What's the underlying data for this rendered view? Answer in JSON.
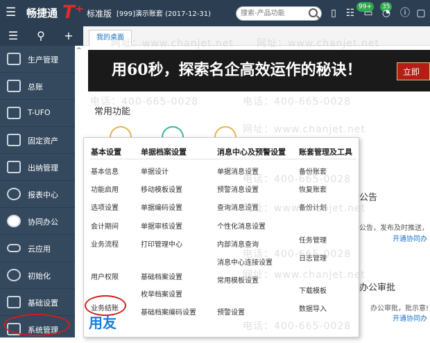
{
  "header": {
    "brand": "畅捷通",
    "brand_mark": "T⁺",
    "edition": "标准版",
    "account": "[999]演示账套  (2017-12-31)",
    "search_placeholder": "搜索-产品功能",
    "badge_messages": "99+",
    "badge_tasks": "35"
  },
  "sidebar": {
    "items": [
      {
        "label": "生产管理",
        "icon": "gears-icon"
      },
      {
        "label": "总账",
        "icon": "ledger-icon"
      },
      {
        "label": "T-UFO",
        "icon": "report-sheet-icon"
      },
      {
        "label": "固定资产",
        "icon": "asset-icon"
      },
      {
        "label": "出纳管理",
        "icon": "cashier-icon"
      },
      {
        "label": "报表中心",
        "icon": "pie-icon"
      },
      {
        "label": "协同办公",
        "icon": "collab-icon"
      },
      {
        "label": "云应用",
        "icon": "cloud-icon"
      },
      {
        "label": "初始化",
        "icon": "clock-icon"
      },
      {
        "label": "基础设置",
        "icon": "settings-icon"
      },
      {
        "label": "系统管理",
        "icon": "system-icon"
      }
    ]
  },
  "tabs": [
    "我的桌面"
  ],
  "banner": {
    "text": "用60秒，探索名企高效运作的秘诀！",
    "button": "立即"
  },
  "desktop": {
    "section_title": "常用功能",
    "side_title_1": "公告",
    "side_text_1": "公告，发布及时推送，",
    "side_link_1": "开通协同办",
    "side_title_2": "办公审批",
    "side_text_2": "办公审批，批示意!",
    "side_link_2": "开通协同办"
  },
  "popup": {
    "columns": [
      {
        "title": "基本设置",
        "items": [
          "基本信息",
          "功能启用",
          "选项设置",
          "会计期间",
          "业务流程",
          "用户权限",
          "业务结账"
        ]
      },
      {
        "title": "单据档案设置",
        "items": [
          "单据设计",
          "移动模板设置",
          "单据编码设置",
          "单据审核设置",
          "打印管理中心",
          "基础档案设置",
          "枚举档案设置",
          "基础档案编码设置"
        ]
      },
      {
        "title": "消息中心及预警设置",
        "items": [
          "单据消息设置",
          "预警消息设置",
          "查询消息设置",
          "个性化消息设置",
          "内部消息查询",
          "消息中心连接设置",
          "常用模板设置",
          "预警设置"
        ]
      },
      {
        "title": "账套管理及工具",
        "items": [
          "备份账套",
          "恢复账套",
          "备份计划",
          "任务管理",
          "日志管理",
          "下载模板",
          "数据导入"
        ]
      }
    ],
    "logo_text": "用友"
  },
  "watermark": {
    "phone": "电话：400-665-0028",
    "site": "网址：www.chanjet.net"
  },
  "colors": {
    "topbar": "#2b3e52",
    "sidebar": "#34495e",
    "accent": "#1a73c9",
    "highlight": "#d21d1d"
  }
}
